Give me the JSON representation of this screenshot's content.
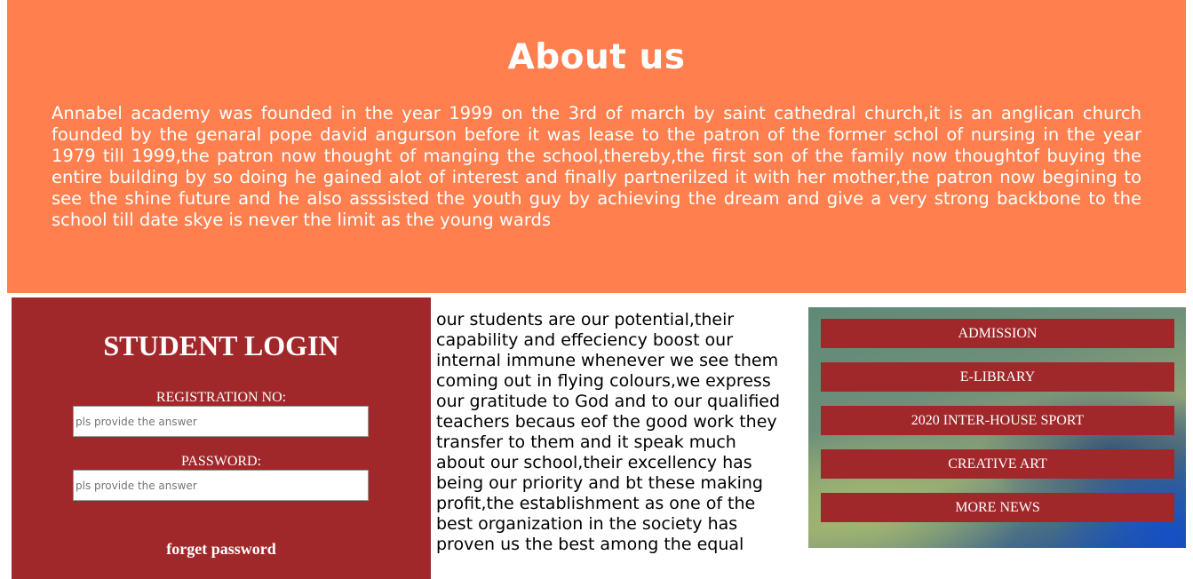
{
  "about": {
    "title": "About us",
    "body": "Annabel academy was founded in the year 1999 on the 3rd of march by saint cathedral church,it is an anglican church founded by the genaral pope david angurson before it was lease to the patron of the former schol of nursing in the year 1979 till 1999,the patron now thought of manging the school,thereby,the first son of the family now thoughtof buying the entire building by so doing he gained alot of interest and finally partnerilzed it with her mother,the patron now begining to see the shine future and he also asssisted the youth guy by achieving the dream and give a very strong backbone to the school till date skye is never the limit as the young wards"
  },
  "login": {
    "title": "STUDENT LOGIN",
    "registration_label": "REGISTRATION NO:",
    "registration_placeholder": "pls provide the answer",
    "password_label": "PASSWORD:",
    "password_placeholder": "pls provide the answer",
    "forget_label": "forget password"
  },
  "middle": {
    "text": "our students are our potential,their capability and effeciency boost our internal immune whenever we see them coming out in flying colours,we express our gratitude to God and to our qualified teachers becaus eof the good work they transfer to them and it speak much about our school,their excellency has being our priority and bt these making profit,the establishment as one of the best organization in the society has proven us the best among the equal"
  },
  "menu": {
    "items": [
      {
        "label": "ADMISSION"
      },
      {
        "label": "E-LIBRARY"
      },
      {
        "label": "2020 INTER-HOUSE SPORT"
      },
      {
        "label": "CREATIVE ART"
      },
      {
        "label": "MORE NEWS"
      }
    ]
  },
  "colors": {
    "about_bg": "#ff7f4f",
    "login_bg": "#a1282a",
    "menu_button_bg": "#a1282a"
  }
}
